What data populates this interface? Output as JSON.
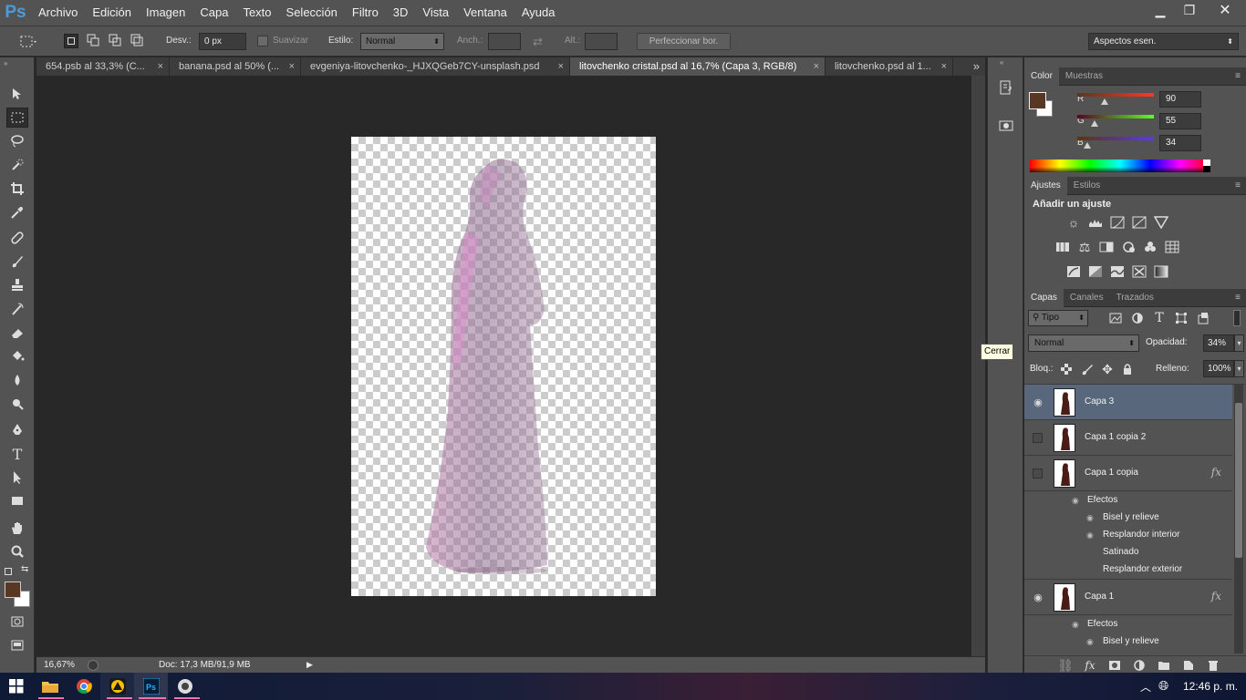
{
  "app": {
    "logo": "Ps"
  },
  "menu": [
    "Archivo",
    "Edición",
    "Imagen",
    "Capa",
    "Texto",
    "Selección",
    "Filtro",
    "3D",
    "Vista",
    "Ventana",
    "Ayuda"
  ],
  "window_controls": {
    "minimize": "▁",
    "restore": "❐",
    "close": "✕"
  },
  "options": {
    "feather_label": "Desv.:",
    "feather_value": "0 px",
    "antialias_label": "Suavizar",
    "style_label": "Estilo:",
    "style_value": "Normal",
    "width_label": "Anch.:",
    "height_label": "Alt.:",
    "refine_button": "Perfeccionar bor.",
    "workspace": "Aspectos esen."
  },
  "tabs": [
    {
      "label": "654.psb al 33,3% (C...",
      "active": false
    },
    {
      "label": "banana.psd al 50% (...",
      "active": false
    },
    {
      "label": "evgeniya-litovchenko-_HJXQGeb7CY-unsplash.psd",
      "active": false
    },
    {
      "label": "litovchenko cristal.psd al 16,7% (Capa 3, RGB/8)",
      "active": true
    },
    {
      "label": "litovchenko.psd al 1...",
      "active": false
    }
  ],
  "tab_close_glyph": "×",
  "tab_overflow": "»",
  "status": {
    "zoom": "16,67%",
    "doc": "Doc: 17,3 MB/91,9 MB"
  },
  "color_panel": {
    "tabs": [
      "Color",
      "Muestras"
    ],
    "foreground_hex": "#5a3722",
    "r_label": "R",
    "r_value": "90",
    "g_label": "G",
    "g_value": "55",
    "b_label": "B",
    "b_value": "34"
  },
  "adjustments_panel": {
    "tabs": [
      "Ajustes",
      "Estilos"
    ],
    "heading": "Añadir un ajuste"
  },
  "layers_panel": {
    "tabs": [
      "Capas",
      "Canales",
      "Trazados"
    ],
    "filter": "Tipo",
    "blend_mode": "Normal",
    "opacity_label": "Opacidad:",
    "opacity_value": "34%",
    "lock_label": "Bloq.:",
    "fill_label": "Relleno:",
    "fill_value": "100%",
    "layers": [
      {
        "name": "Capa 3",
        "visible": true,
        "selected": true,
        "fx": false
      },
      {
        "name": "Capa 1 copia 2",
        "visible": false,
        "selected": false,
        "fx": false
      },
      {
        "name": "Capa 1 copia",
        "visible": false,
        "selected": false,
        "fx": true
      }
    ],
    "effects_label": "Efectos",
    "copia_effects": [
      "Bisel y relieve",
      "Resplandor interior",
      "Satinado",
      "Resplandor exterior"
    ],
    "capa1": {
      "name": "Capa 1",
      "visible": true,
      "fx": true
    },
    "capa1_effects": [
      "Bisel y relieve"
    ]
  },
  "tooltip": "Cerrar",
  "taskbar": {
    "time": "12:46 p. m."
  }
}
